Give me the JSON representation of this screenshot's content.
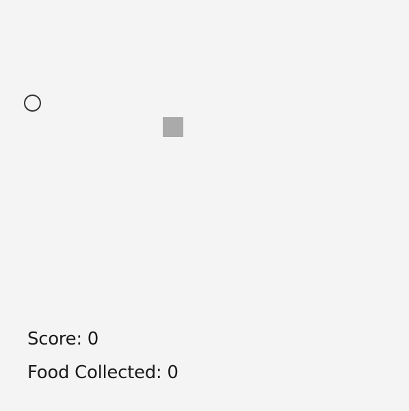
{
  "hud": {
    "score_label": "Score: ",
    "score_value": "0",
    "food_label": "Food Collected: ",
    "food_value": "0"
  },
  "colors": {
    "background": "#f4f4f4",
    "player_outline": "#333333",
    "food": "#aaaaaa",
    "text": "#1a1a1a"
  },
  "icons": {
    "player": "hollow-circle",
    "food": "gray-square"
  }
}
